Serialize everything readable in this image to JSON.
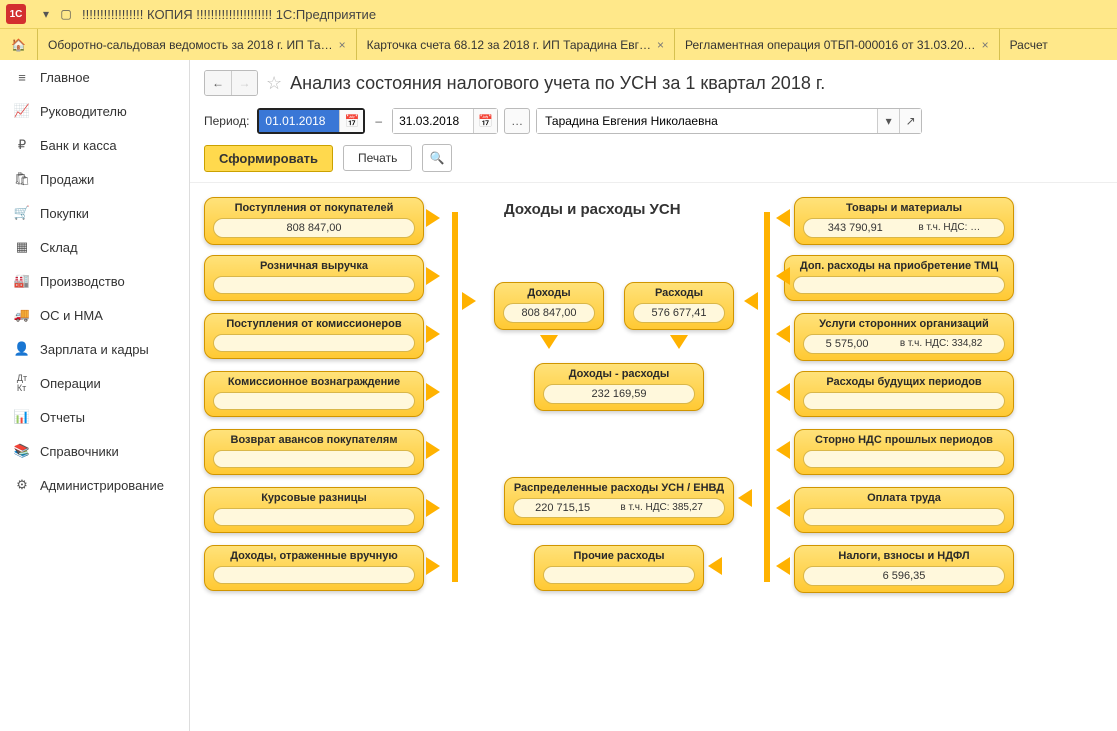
{
  "titlebar": {
    "title": "!!!!!!!!!!!!!!!!! КОПИЯ !!!!!!!!!!!!!!!!!!!!! 1С:Предприятие"
  },
  "tabs": [
    {
      "label": "Оборотно-сальдовая ведомость за 2018 г. ИП Та…"
    },
    {
      "label": "Карточка счета 68.12 за 2018 г. ИП Тарадина Евг…"
    },
    {
      "label": "Регламентная операция 0ТБП-000016 от 31.03.20…"
    },
    {
      "label": "Расчет"
    }
  ],
  "sidebar": {
    "items": [
      {
        "icon": "menu-icon",
        "label": "Главное"
      },
      {
        "icon": "chart-icon",
        "label": "Руководителю"
      },
      {
        "icon": "ruble-icon",
        "label": "Банк и касса"
      },
      {
        "icon": "bag-icon",
        "label": "Продажи"
      },
      {
        "icon": "cart-icon",
        "label": "Покупки"
      },
      {
        "icon": "grid-icon",
        "label": "Склад"
      },
      {
        "icon": "factory-icon",
        "label": "Производство"
      },
      {
        "icon": "truck-icon",
        "label": "ОС и НМА"
      },
      {
        "icon": "person-icon",
        "label": "Зарплата и кадры"
      },
      {
        "icon": "dtkt-icon",
        "label": "Операции"
      },
      {
        "icon": "bars-icon",
        "label": "Отчеты"
      },
      {
        "icon": "books-icon",
        "label": "Справочники"
      },
      {
        "icon": "gear-icon",
        "label": "Администрирование"
      }
    ]
  },
  "page": {
    "title": "Анализ состояния налогового учета по УСН за 1 квартал 2018 г.",
    "period_label": "Период:",
    "date_from": "01.01.2018",
    "date_to": "31.03.2018",
    "org": "Тарадина Евгения Николаевна",
    "btn_form": "Сформировать",
    "btn_print": "Печать"
  },
  "diagram": {
    "header": "Доходы и расходы УСН",
    "left": [
      {
        "title": "Поступления от покупателей",
        "value": "808 847,00"
      },
      {
        "title": "Розничная выручка",
        "value": ""
      },
      {
        "title": "Поступления от комиссионеров",
        "value": ""
      },
      {
        "title": "Комиссионное вознаграждение",
        "value": ""
      },
      {
        "title": "Возврат авансов покупателям",
        "value": ""
      },
      {
        "title": "Курсовые разницы",
        "value": ""
      },
      {
        "title": "Доходы, отраженные вручную",
        "value": ""
      }
    ],
    "center": {
      "incomes": {
        "title": "Доходы",
        "value": "808 847,00"
      },
      "expenses": {
        "title": "Расходы",
        "value": "576 677,41"
      },
      "diff": {
        "title": "Доходы - расходы",
        "value": "232 169,59"
      },
      "dist": {
        "title": "Распределенные расходы УСН / ЕНВД",
        "value": "220 715,15",
        "nds": "в т.ч. НДС: 385,27"
      },
      "other": {
        "title": "Прочие расходы",
        "value": ""
      }
    },
    "right": [
      {
        "title": "Товары и материалы",
        "value": "343 790,91",
        "nds": "в т.ч. НДС: …"
      },
      {
        "title": "Доп. расходы на приобретение ТМЦ",
        "value": ""
      },
      {
        "title": "Услуги сторонних организаций",
        "value": "5 575,00",
        "nds": "в т.ч. НДС: 334,82"
      },
      {
        "title": "Расходы будущих периодов",
        "value": ""
      },
      {
        "title": "Сторно НДС прошлых периодов",
        "value": ""
      },
      {
        "title": "Оплата труда",
        "value": ""
      },
      {
        "title": "Налоги, взносы и НДФЛ",
        "value": "6 596,35"
      }
    ]
  }
}
